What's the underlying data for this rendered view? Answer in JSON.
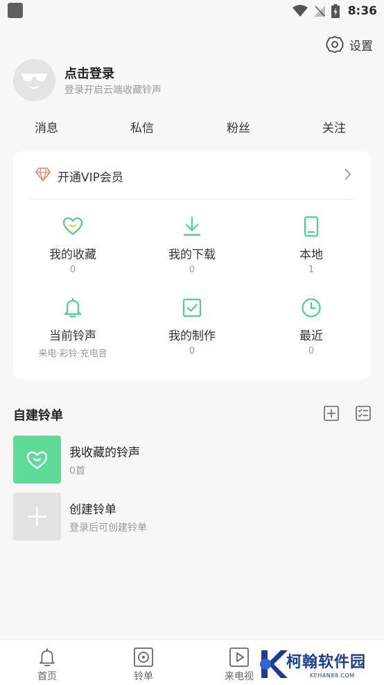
{
  "status_bar": {
    "time": "8:36",
    "icons": [
      "wifi-icon",
      "signal-icon",
      "battery-icon"
    ]
  },
  "header": {
    "settings_label": "设置",
    "login_title": "点击登录",
    "login_subtitle": "登录开启云端收藏铃声"
  },
  "quick_links": [
    {
      "label": "消息"
    },
    {
      "label": "私信"
    },
    {
      "label": "粉丝"
    },
    {
      "label": "关注"
    }
  ],
  "card": {
    "vip_label": "开通VIP会员",
    "items": [
      {
        "label": "我的收藏",
        "sub": "0",
        "icon": "heart-icon"
      },
      {
        "label": "我的下载",
        "sub": "0",
        "icon": "download-icon"
      },
      {
        "label": "本地",
        "sub": "1",
        "icon": "phone-icon"
      },
      {
        "label": "当前铃声",
        "sub": "来电·彩铃·充电音",
        "icon": "bell-icon"
      },
      {
        "label": "我的制作",
        "sub": "0",
        "icon": "checkbox-icon"
      },
      {
        "label": "最近",
        "sub": "0",
        "icon": "clock-icon"
      }
    ]
  },
  "playlists": {
    "title": "自建铃单",
    "items": [
      {
        "title": "我收藏的铃声",
        "sub": "0首"
      },
      {
        "title": "创建铃单",
        "sub": "登录后可创建铃单"
      }
    ]
  },
  "bottom_nav": [
    {
      "label": "首页",
      "icon": "bell-icon"
    },
    {
      "label": "铃单",
      "icon": "disc-icon"
    },
    {
      "label": "来电视",
      "icon": "play-icon"
    }
  ],
  "watermark": {
    "text": "柯翰软件园",
    "url": "KEHAN88.COM"
  },
  "colors": {
    "accent": "#4cd08a",
    "vip": "#e8836e",
    "background": "#f7f7f7",
    "brand_watermark": "#1b3f8e"
  }
}
